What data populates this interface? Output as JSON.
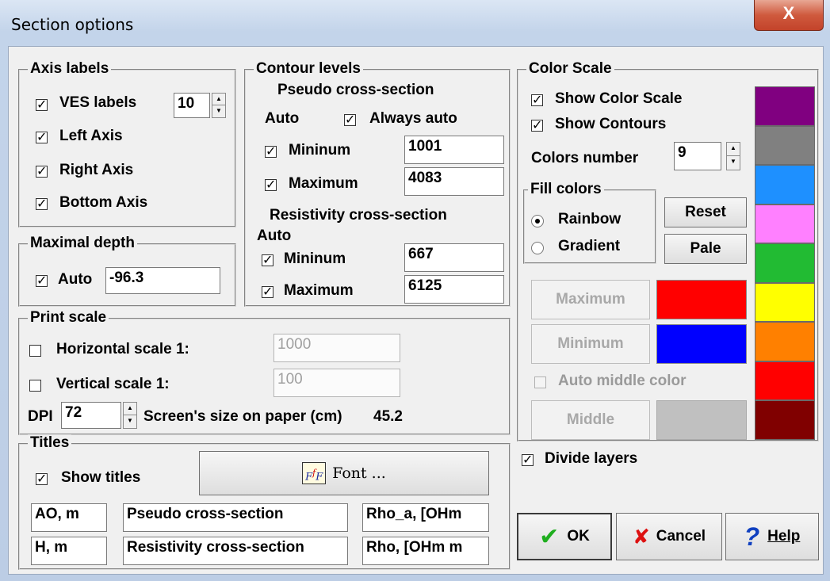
{
  "window": {
    "title": "Section options",
    "close_glyph": "X"
  },
  "axis_labels": {
    "title": "Axis labels",
    "ves_labels": "VES labels",
    "ves_value": "10",
    "left_axis": "Left Axis",
    "right_axis": "Right Axis",
    "bottom_axis": "Bottom Axis"
  },
  "maximal_depth": {
    "title": "Maximal depth",
    "auto": "Auto",
    "value": "-96.3"
  },
  "contour_levels": {
    "title": "Contour levels",
    "pseudo_title": "Pseudo cross-section",
    "auto": "Auto",
    "always_auto": "Always auto",
    "minimum": "Mininum",
    "maximum": "Maximum",
    "pseudo_min": "1001",
    "pseudo_max": "4083",
    "resist_title": "Resistivity cross-section",
    "resist_auto": "Auto",
    "resist_min": "667",
    "resist_max": "6125"
  },
  "print_scale": {
    "title": "Print scale",
    "horizontal": "Horizontal scale 1:",
    "horizontal_value": "1000",
    "vertical": "Vertical scale 1:",
    "vertical_value": "100",
    "dpi": "DPI",
    "dpi_value": "72",
    "screen_size": "Screen's size on paper (cm)",
    "screen_size_value": "45.2"
  },
  "titles": {
    "title": "Titles",
    "show_titles": "Show titles",
    "font_button": "Font ...",
    "row1": [
      "AO, m",
      "Pseudo cross-section",
      "Rho_a, [OHm"
    ],
    "row2": [
      "H, m",
      "Resistivity cross-section",
      "Rho, [OHm m"
    ]
  },
  "color_scale": {
    "title": "Color Scale",
    "show_color_scale": "Show Color Scale",
    "show_contours": "Show Contours",
    "colors_number": "Colors number",
    "colors_number_value": "9",
    "fill_colors": "Fill colors",
    "rainbow": "Rainbow",
    "gradient": "Gradient",
    "reset": "Reset",
    "pale": "Pale",
    "maximum": "Maximum",
    "minimum": "Minimum",
    "auto_middle": "Auto middle color",
    "middle": "Middle",
    "max_color": "#ff0000",
    "min_color": "#0000ff",
    "middle_color": "#c0c0c0",
    "palette": [
      "#800080",
      "#808080",
      "#1e90ff",
      "#ff80ff",
      "#22bb33",
      "#ffff00",
      "#ff8000",
      "#ff0000",
      "#800000"
    ]
  },
  "divide_layers": "Divide layers",
  "buttons": {
    "ok": "OK",
    "cancel": "Cancel",
    "help": "Help"
  }
}
